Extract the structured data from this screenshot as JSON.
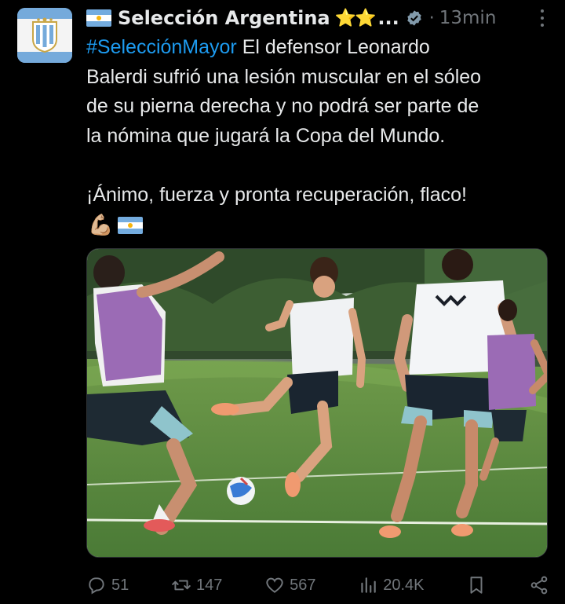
{
  "account": {
    "name": "Selección Argentina",
    "stars": "⭐⭐",
    "ellipsis": "...",
    "separator": "·",
    "time": "13min"
  },
  "tweet": {
    "hashtag": "#SelecciónMayor",
    "line1_rest": " El defensor Leonardo",
    "line2": "Balerdi sufrió una lesión muscular en el sóleo",
    "line3": "de su pierna derecha y no podrá ser parte de",
    "line4": "la nómina que jugará la Copa del Mundo.",
    "line5": "¡Ánimo, fuerza y pronta recuperación, flaco!",
    "emoji_muscle": "💪🏼"
  },
  "actions": {
    "replies": "51",
    "retweets": "147",
    "likes": "567",
    "views": "20.4K"
  },
  "icons": [
    "argentina-flag-icon",
    "star-icon",
    "verified-badge-icon",
    "more-options-icon",
    "reply-icon",
    "retweet-icon",
    "like-icon",
    "views-icon",
    "bookmark-icon",
    "share-icon"
  ],
  "colors": {
    "background": "#000000",
    "text": "#e7e9ea",
    "secondary": "#71767b",
    "link": "#1d9bf0",
    "flag_blue": "#74acdf"
  }
}
